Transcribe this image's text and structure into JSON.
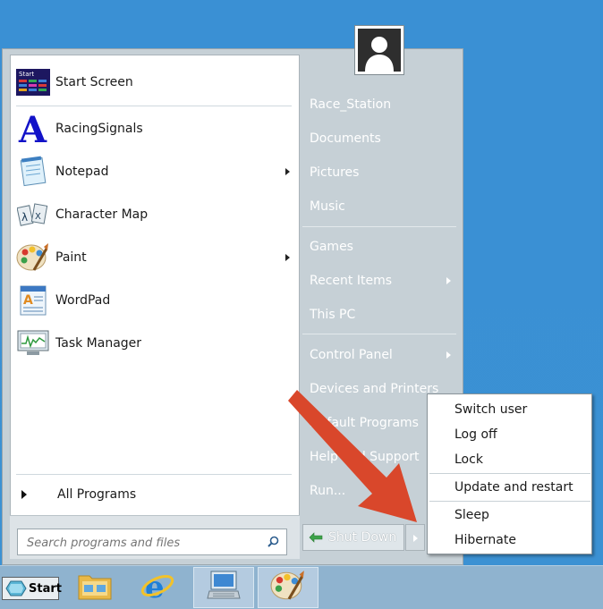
{
  "left_pane": {
    "pinned": [
      {
        "label": "Start Screen",
        "icon": "start-screen-icon"
      }
    ],
    "programs": [
      {
        "label": "RacingSignals",
        "icon": "racing-signals-icon",
        "submenu": false
      },
      {
        "label": "Notepad",
        "icon": "notepad-icon",
        "submenu": true
      },
      {
        "label": "Character Map",
        "icon": "character-map-icon",
        "submenu": false
      },
      {
        "label": "Paint",
        "icon": "paint-icon",
        "submenu": true
      },
      {
        "label": "WordPad",
        "icon": "wordpad-icon",
        "submenu": false
      },
      {
        "label": "Task Manager",
        "icon": "task-manager-icon",
        "submenu": false
      }
    ],
    "all_programs": "All Programs",
    "search_placeholder": "Search programs and files"
  },
  "right_pane": {
    "user_name": "Race_Station",
    "items": [
      {
        "label": "Documents"
      },
      {
        "label": "Pictures"
      },
      {
        "label": "Music"
      },
      {
        "label": "Games"
      },
      {
        "label": "Recent Items"
      },
      {
        "label": "This PC"
      },
      {
        "label": "Control Panel"
      },
      {
        "label": "Devices and Printers"
      },
      {
        "label": "Default Programs"
      },
      {
        "label": "Help and Support"
      },
      {
        "label": "Run..."
      }
    ],
    "shutdown_label": "Shut Down"
  },
  "shutdown_menu": {
    "items": [
      "Switch user",
      "Log off",
      "Lock",
      "Update and restart",
      "Sleep",
      "Hibernate"
    ]
  },
  "taskbar": {
    "start_label": "Start",
    "items": [
      "file-explorer-icon",
      "internet-explorer-icon",
      "remote-desktop-icon",
      "paint-icon"
    ]
  },
  "colors": {
    "desktop": "#3b8fd2",
    "annotation_arrow": "#d9472b",
    "taskbar": "#8fb3cf"
  }
}
